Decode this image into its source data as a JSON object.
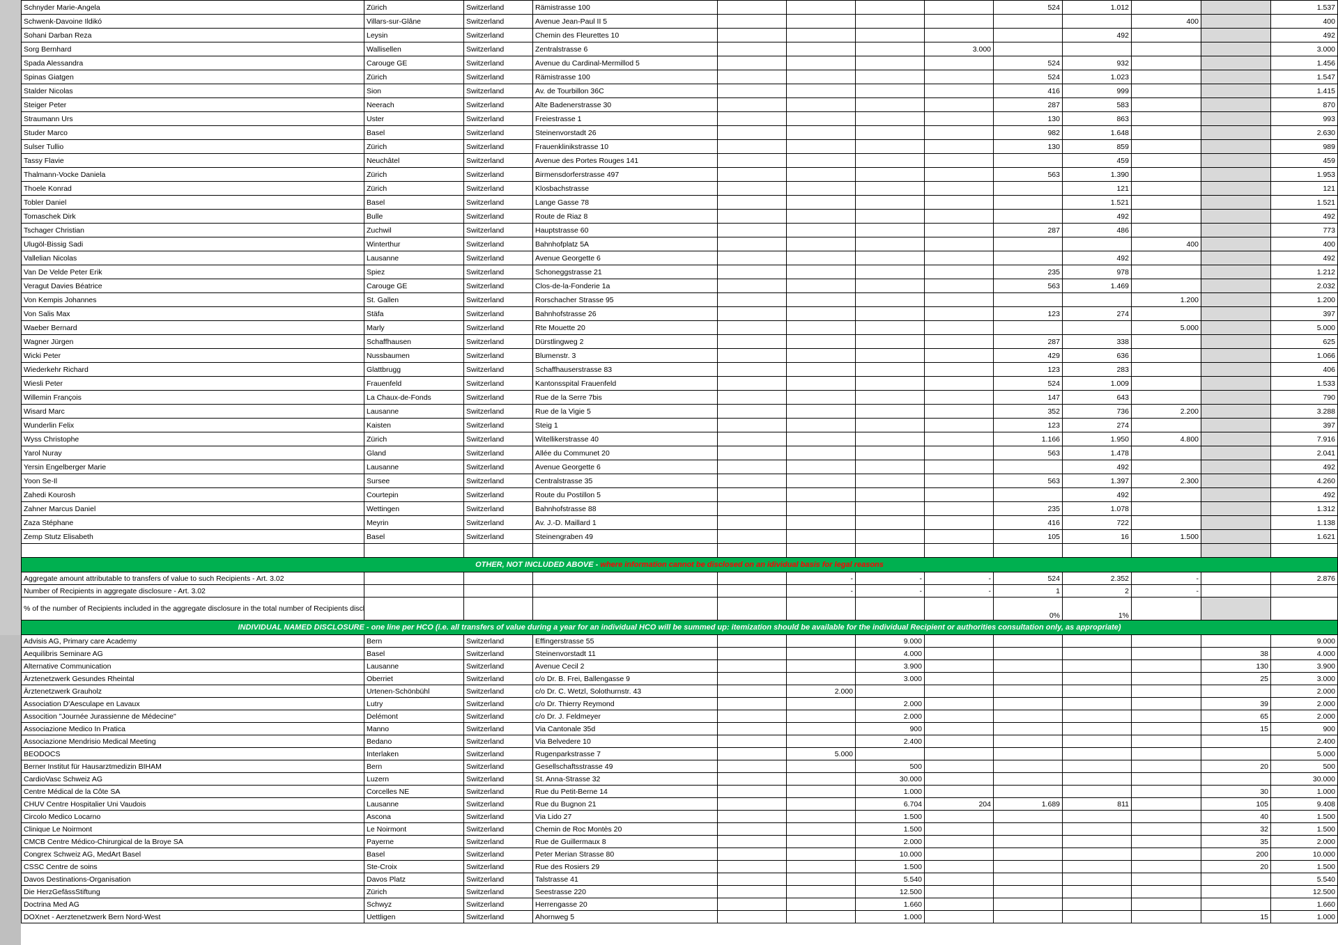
{
  "section_other": {
    "title": "OTHER, NOT INCLUDED ABOVE - ",
    "note": "where information cannot be disclosed on an idividual basis for legal reasons"
  },
  "section_hco": {
    "title": "INDIVIDUAL NAMED DISCLOSURE - one line per HCO (i.e. all transfers of value during a year for an individual HCO will be summed up: itemization should be available for the individual Recipient or authorities consultation only, as appropriate)"
  },
  "hcp_rows": [
    {
      "name": "Schnyder Marie-Angela",
      "city": "Zürich",
      "country": "Switzerland",
      "address": "Rämistrasse 100",
      "v": [
        "",
        "",
        "",
        "",
        "524",
        "1.012",
        "",
        "",
        "1.537"
      ]
    },
    {
      "name": "Schwenk-Davoine Ildikó",
      "city": "Villars-sur-Glâne",
      "country": "Switzerland",
      "address": "Avenue Jean-Paul II 5",
      "v": [
        "",
        "",
        "",
        "",
        "",
        "",
        "400",
        "",
        "400"
      ]
    },
    {
      "name": "Sohani Darban Reza",
      "city": "Leysin",
      "country": "Switzerland",
      "address": "Chemin des Fleurettes 10",
      "v": [
        "",
        "",
        "",
        "",
        "",
        "492",
        "",
        "",
        "492"
      ]
    },
    {
      "name": "Sorg Bernhard",
      "city": "Wallisellen",
      "country": "Switzerland",
      "address": "Zentralstrasse 6",
      "v": [
        "",
        "",
        "",
        "3.000",
        "",
        "",
        "",
        "",
        "3.000"
      ]
    },
    {
      "name": "Spada Alessandra",
      "city": "Carouge GE",
      "country": "Switzerland",
      "address": "Avenue du Cardinal-Mermillod 5",
      "v": [
        "",
        "",
        "",
        "",
        "524",
        "932",
        "",
        "",
        "1.456"
      ]
    },
    {
      "name": "Spinas Giatgen",
      "city": "Zürich",
      "country": "Switzerland",
      "address": "Rämistrasse 100",
      "v": [
        "",
        "",
        "",
        "",
        "524",
        "1.023",
        "",
        "",
        "1.547"
      ]
    },
    {
      "name": "Stalder Nicolas",
      "city": "Sion",
      "country": "Switzerland",
      "address": "Av. de Tourbillon 36C",
      "v": [
        "",
        "",
        "",
        "",
        "416",
        "999",
        "",
        "",
        "1.415"
      ]
    },
    {
      "name": "Steiger Peter",
      "city": "Neerach",
      "country": "Switzerland",
      "address": "Alte Badenerstrasse 30",
      "v": [
        "",
        "",
        "",
        "",
        "287",
        "583",
        "",
        "",
        "870"
      ]
    },
    {
      "name": "Straumann Urs",
      "city": "Uster",
      "country": "Switzerland",
      "address": "Freiestrasse 1",
      "v": [
        "",
        "",
        "",
        "",
        "130",
        "863",
        "",
        "",
        "993"
      ]
    },
    {
      "name": "Studer Marco",
      "city": "Basel",
      "country": "Switzerland",
      "address": "Steinenvorstadt 26",
      "v": [
        "",
        "",
        "",
        "",
        "982",
        "1.648",
        "",
        "",
        "2.630"
      ]
    },
    {
      "name": "Sulser Tullio",
      "city": "Zürich",
      "country": "Switzerland",
      "address": "Frauenklinikstrasse 10",
      "v": [
        "",
        "",
        "",
        "",
        "130",
        "859",
        "",
        "",
        "989"
      ]
    },
    {
      "name": "Tassy Flavie",
      "city": "Neuchâtel",
      "country": "Switzerland",
      "address": "Avenue des Portes Rouges 141",
      "v": [
        "",
        "",
        "",
        "",
        "",
        "459",
        "",
        "",
        "459"
      ]
    },
    {
      "name": "Thalmann-Vocke Daniela",
      "city": "Zürich",
      "country": "Switzerland",
      "address": "Birmensdorferstrasse 497",
      "v": [
        "",
        "",
        "",
        "",
        "563",
        "1.390",
        "",
        "",
        "1.953"
      ]
    },
    {
      "name": "Thoele Konrad",
      "city": "Zürich",
      "country": "Switzerland",
      "address": "Klosbachstrasse",
      "v": [
        "",
        "",
        "",
        "",
        "",
        "121",
        "",
        "",
        "121"
      ]
    },
    {
      "name": "Tobler Daniel",
      "city": "Basel",
      "country": "Switzerland",
      "address": "Lange Gasse 78",
      "v": [
        "",
        "",
        "",
        "",
        "",
        "1.521",
        "",
        "",
        "1.521"
      ]
    },
    {
      "name": "Tomaschek Dirk",
      "city": "Bulle",
      "country": "Switzerland",
      "address": "Route de Riaz 8",
      "v": [
        "",
        "",
        "",
        "",
        "",
        "492",
        "",
        "",
        "492"
      ]
    },
    {
      "name": "Tschager Christian",
      "city": "Zuchwil",
      "country": "Switzerland",
      "address": "Hauptstrasse 60",
      "v": [
        "",
        "",
        "",
        "",
        "287",
        "486",
        "",
        "",
        "773"
      ]
    },
    {
      "name": "Ulugöl-Bissig Sadi",
      "city": "Winterthur",
      "country": "Switzerland",
      "address": "Bahnhofplatz 5A",
      "v": [
        "",
        "",
        "",
        "",
        "",
        "",
        "400",
        "",
        "400"
      ]
    },
    {
      "name": "Vallelian Nicolas",
      "city": "Lausanne",
      "country": "Switzerland",
      "address": "Avenue Georgette 6",
      "v": [
        "",
        "",
        "",
        "",
        "",
        "492",
        "",
        "",
        "492"
      ]
    },
    {
      "name": "Van De Velde Peter Erik",
      "city": "Spiez",
      "country": "Switzerland",
      "address": "Schoneggstrasse 21",
      "v": [
        "",
        "",
        "",
        "",
        "235",
        "978",
        "",
        "",
        "1.212"
      ]
    },
    {
      "name": "Veragut Davies Béatrice",
      "city": "Carouge GE",
      "country": "Switzerland",
      "address": "Clos-de-la-Fonderie 1a",
      "v": [
        "",
        "",
        "",
        "",
        "563",
        "1.469",
        "",
        "",
        "2.032"
      ]
    },
    {
      "name": "Von Kempis Johannes",
      "city": "St. Gallen",
      "country": "Switzerland",
      "address": "Rorschacher Strasse 95",
      "v": [
        "",
        "",
        "",
        "",
        "",
        "",
        "1.200",
        "",
        "1.200"
      ]
    },
    {
      "name": "Von Salis Max",
      "city": "Stäfa",
      "country": "Switzerland",
      "address": "Bahnhofstrasse 26",
      "v": [
        "",
        "",
        "",
        "",
        "123",
        "274",
        "",
        "",
        "397"
      ]
    },
    {
      "name": "Waeber Bernard",
      "city": "Marly",
      "country": "Switzerland",
      "address": "Rte Mouette 20",
      "v": [
        "",
        "",
        "",
        "",
        "",
        "",
        "5.000",
        "",
        "5.000"
      ]
    },
    {
      "name": "Wagner Jürgen",
      "city": "Schaffhausen",
      "country": "Switzerland",
      "address": "Dürstlingweg 2",
      "v": [
        "",
        "",
        "",
        "",
        "287",
        "338",
        "",
        "",
        "625"
      ]
    },
    {
      "name": "Wicki Peter",
      "city": "Nussbaumen",
      "country": "Switzerland",
      "address": "Blumenstr. 3",
      "v": [
        "",
        "",
        "",
        "",
        "429",
        "636",
        "",
        "",
        "1.066"
      ]
    },
    {
      "name": "Wiederkehr Richard",
      "city": "Glattbrugg",
      "country": "Switzerland",
      "address": "Schaffhauserstrasse 83",
      "v": [
        "",
        "",
        "",
        "",
        "123",
        "283",
        "",
        "",
        "406"
      ]
    },
    {
      "name": "Wiesli Peter",
      "city": "Frauenfeld",
      "country": "Switzerland",
      "address": "Kantonsspital Frauenfeld",
      "v": [
        "",
        "",
        "",
        "",
        "524",
        "1.009",
        "",
        "",
        "1.533"
      ]
    },
    {
      "name": "Willemin François",
      "city": "La Chaux-de-Fonds",
      "country": "Switzerland",
      "address": "Rue de la Serre 7bis",
      "v": [
        "",
        "",
        "",
        "",
        "147",
        "643",
        "",
        "",
        "790"
      ]
    },
    {
      "name": "Wisard Marc",
      "city": "Lausanne",
      "country": "Switzerland",
      "address": "Rue de la Vigie  5",
      "v": [
        "",
        "",
        "",
        "",
        "352",
        "736",
        "2.200",
        "",
        "3.288"
      ]
    },
    {
      "name": "Wunderlin Felix",
      "city": "Kaisten",
      "country": "Switzerland",
      "address": "Steig 1",
      "v": [
        "",
        "",
        "",
        "",
        "123",
        "274",
        "",
        "",
        "397"
      ]
    },
    {
      "name": "Wyss Christophe",
      "city": "Zürich",
      "country": "Switzerland",
      "address": "Witellikerstrasse 40",
      "v": [
        "",
        "",
        "",
        "",
        "1.166",
        "1.950",
        "4.800",
        "",
        "7.916"
      ]
    },
    {
      "name": "Yarol Nuray",
      "city": "Gland",
      "country": "Switzerland",
      "address": "Allée du Communet 20",
      "v": [
        "",
        "",
        "",
        "",
        "563",
        "1.478",
        "",
        "",
        "2.041"
      ]
    },
    {
      "name": "Yersin Engelberger Marie",
      "city": "Lausanne",
      "country": "Switzerland",
      "address": "Avenue Georgette 6",
      "v": [
        "",
        "",
        "",
        "",
        "",
        "492",
        "",
        "",
        "492"
      ]
    },
    {
      "name": "Yoon Se-Il",
      "city": "Sursee",
      "country": "Switzerland",
      "address": "Centralstrasse 35",
      "v": [
        "",
        "",
        "",
        "",
        "563",
        "1.397",
        "2.300",
        "",
        "4.260"
      ]
    },
    {
      "name": "Zahedi Kourosh",
      "city": "Courtepin",
      "country": "Switzerland",
      "address": "Route du Postillon 5",
      "v": [
        "",
        "",
        "",
        "",
        "",
        "492",
        "",
        "",
        "492"
      ]
    },
    {
      "name": "Zahner Marcus Daniel",
      "city": "Wettingen",
      "country": "Switzerland",
      "address": "Bahnhofstrasse 88",
      "v": [
        "",
        "",
        "",
        "",
        "235",
        "1.078",
        "",
        "",
        "1.312"
      ]
    },
    {
      "name": "Zaza Stéphane",
      "city": "Meyrin",
      "country": "Switzerland",
      "address": "Av. J.-D. Maillard 1",
      "v": [
        "",
        "",
        "",
        "",
        "416",
        "722",
        "",
        "",
        "1.138"
      ]
    },
    {
      "name": "Zemp Stutz Elisabeth",
      "city": "Basel",
      "country": "Switzerland",
      "address": "Steinengraben 49",
      "v": [
        "",
        "",
        "",
        "",
        "105",
        "16",
        "1.500",
        "",
        "1.621"
      ]
    }
  ],
  "aggregate": {
    "amount_label": "Aggregate amount attributable to transfers of value to such Recipients - Art. 3.02",
    "amount_values": [
      "-",
      "-",
      "-",
      "524",
      "2.352",
      "-",
      "",
      "2.876"
    ],
    "count_label": "Number of Recipients in aggregate disclosure - Art. 3.02",
    "count_values": [
      "-",
      "-",
      "-",
      "1",
      "2",
      "-",
      "",
      ""
    ],
    "pct_label": "% of the number of Recipients included in the aggregate disclosure in the total number of Recipients disclosed - Art. 3.02",
    "pct_values": [
      "",
      "",
      "",
      "0%",
      "1%",
      "",
      "",
      ""
    ]
  },
  "hco_rows": [
    {
      "name": "Advisis AG, Primary care Academy",
      "city": "Bern",
      "country": "Switzerland",
      "address": "Effingerstrasse 55",
      "v": [
        "",
        "9.000",
        "",
        "",
        "",
        "",
        "",
        "9.000"
      ]
    },
    {
      "name": "Aequilibris Seminare AG",
      "city": "Basel",
      "country": "Switzerland",
      "address": "Steinenvorstadt 11",
      "v": [
        "",
        "4.000",
        "",
        "",
        "",
        "",
        "38",
        "4.000"
      ]
    },
    {
      "name": "Alternative Communication",
      "city": "Lausanne",
      "country": "Switzerland",
      "address": "Avenue Cecil 2",
      "v": [
        "",
        "3.900",
        "",
        "",
        "",
        "",
        "130",
        "3.900"
      ]
    },
    {
      "name": "Ärztenetzwerk Gesundes Rheintal",
      "city": "Oberriet",
      "country": "Switzerland",
      "address": "c/o Dr. B. Frei, Ballengasse 9",
      "v": [
        "",
        "3.000",
        "",
        "",
        "",
        "",
        "25",
        "3.000"
      ]
    },
    {
      "name": "Ärztenetzwerk Grauholz",
      "city": "Urtenen-Schönbühl",
      "country": "Switzerland",
      "address": "c/o Dr. C. Wetzl,  Solothurnstr. 43",
      "v": [
        "2.000",
        "",
        "",
        "",
        "",
        "",
        "",
        "2.000"
      ]
    },
    {
      "name": "Association D'Aesculape en Lavaux",
      "city": "Lutry",
      "country": "Switzerland",
      "address": "c/o Dr. Thierry Reymond",
      "v": [
        "",
        "2.000",
        "",
        "",
        "",
        "",
        "39",
        "2.000"
      ]
    },
    {
      "name": "Assocition \"Journée Jurassienne de Médecine\"",
      "city": "Delémont",
      "country": "Switzerland",
      "address": "c/o Dr. J. Feldmeyer",
      "v": [
        "",
        "2.000",
        "",
        "",
        "",
        "",
        "65",
        "2.000"
      ]
    },
    {
      "name": "Associazione Medico In Pratica",
      "city": "Manno",
      "country": "Switzerland",
      "address": "Via Cantonale 35d",
      "v": [
        "",
        "900",
        "",
        "",
        "",
        "",
        "15",
        "900"
      ]
    },
    {
      "name": "Associazione Mendrisio Medical Meeting",
      "city": "Bedano",
      "country": "Switzerland",
      "address": "Via Belvedere 10",
      "v": [
        "",
        "2.400",
        "",
        "",
        "",
        "",
        "",
        "2.400"
      ]
    },
    {
      "name": "BEODOCS",
      "city": "Interlaken",
      "country": "Switzerland",
      "address": "Rugenparkstrasse 7",
      "v": [
        "5.000",
        "",
        "",
        "",
        "",
        "",
        "",
        "5.000"
      ]
    },
    {
      "name": "Berner Institut für Hausarztmedizin BIHAM",
      "city": "Bern",
      "country": "Switzerland",
      "address": "Gesellschaftsstrasse 49",
      "v": [
        "",
        "500",
        "",
        "",
        "",
        "",
        "20",
        "500"
      ]
    },
    {
      "name": "CardioVasc Schweiz AG",
      "city": "Luzern",
      "country": "Switzerland",
      "address": "St. Anna-Strasse 32",
      "v": [
        "",
        "30.000",
        "",
        "",
        "",
        "",
        "",
        "30.000"
      ]
    },
    {
      "name": "Centre Médical de la Côte SA",
      "city": "Corcelles NE",
      "country": "Switzerland",
      "address": "Rue du Petit-Berne 14",
      "v": [
        "",
        "1.000",
        "",
        "",
        "",
        "",
        "30",
        "1.000"
      ]
    },
    {
      "name": "CHUV Centre Hospitalier Uni Vaudois",
      "city": "Lausanne",
      "country": "Switzerland",
      "address": "Rue du Bugnon 21",
      "v": [
        "",
        "6.704",
        "204",
        "1.689",
        "811",
        "",
        "105",
        "9.408"
      ]
    },
    {
      "name": "Circolo Medico Locarno",
      "city": "Ascona",
      "country": "Switzerland",
      "address": "Via Lido 27",
      "v": [
        "",
        "1.500",
        "",
        "",
        "",
        "",
        "40",
        "1.500"
      ]
    },
    {
      "name": "Clinique Le Noirmont",
      "city": "Le Noirmont",
      "country": "Switzerland",
      "address": "Chemin de Roc Montès 20",
      "v": [
        "",
        "1.500",
        "",
        "",
        "",
        "",
        "32",
        "1.500"
      ]
    },
    {
      "name": "CMCB Centre Médico-Chirurgical de la Broye SA",
      "city": "Payerne",
      "country": "Switzerland",
      "address": "Rue de Guillermaux 8",
      "v": [
        "",
        "2.000",
        "",
        "",
        "",
        "",
        "35",
        "2.000"
      ]
    },
    {
      "name": "Congrex Schweiz AG,  MedArt Basel",
      "city": "Basel",
      "country": "Switzerland",
      "address": "Peter Merian Strasse 80",
      "v": [
        "",
        "10.000",
        "",
        "",
        "",
        "",
        "200",
        "10.000"
      ]
    },
    {
      "name": "CSSC Centre de soins",
      "city": "Ste-Croix",
      "country": "Switzerland",
      "address": "Rue des Rosiers 29",
      "v": [
        "",
        "1.500",
        "",
        "",
        "",
        "",
        "20",
        "1.500"
      ]
    },
    {
      "name": "Davos Destinations-Organisation",
      "city": "Davos Platz",
      "country": "Switzerland",
      "address": "Talstrasse 41",
      "v": [
        "",
        "5.540",
        "",
        "",
        "",
        "",
        "",
        "5.540"
      ]
    },
    {
      "name": "Die HerzGefässStiftung",
      "city": "Zürich",
      "country": "Switzerland",
      "address": "Seestrasse 220",
      "v": [
        "",
        "12.500",
        "",
        "",
        "",
        "",
        "",
        "12.500"
      ]
    },
    {
      "name": "Doctrina Med AG",
      "city": "Schwyz",
      "country": "Switzerland",
      "address": "Herrengasse 20",
      "v": [
        "",
        "1.660",
        "",
        "",
        "",
        "",
        "",
        "1.660"
      ]
    },
    {
      "name": "DOXnet - Aerztenetzwerk Bern Nord-West",
      "city": "Uettligen",
      "country": "Switzerland",
      "address": "Ahornweg 5",
      "v": [
        "",
        "1.000",
        "",
        "",
        "",
        "",
        "15",
        "1.000"
      ]
    }
  ]
}
